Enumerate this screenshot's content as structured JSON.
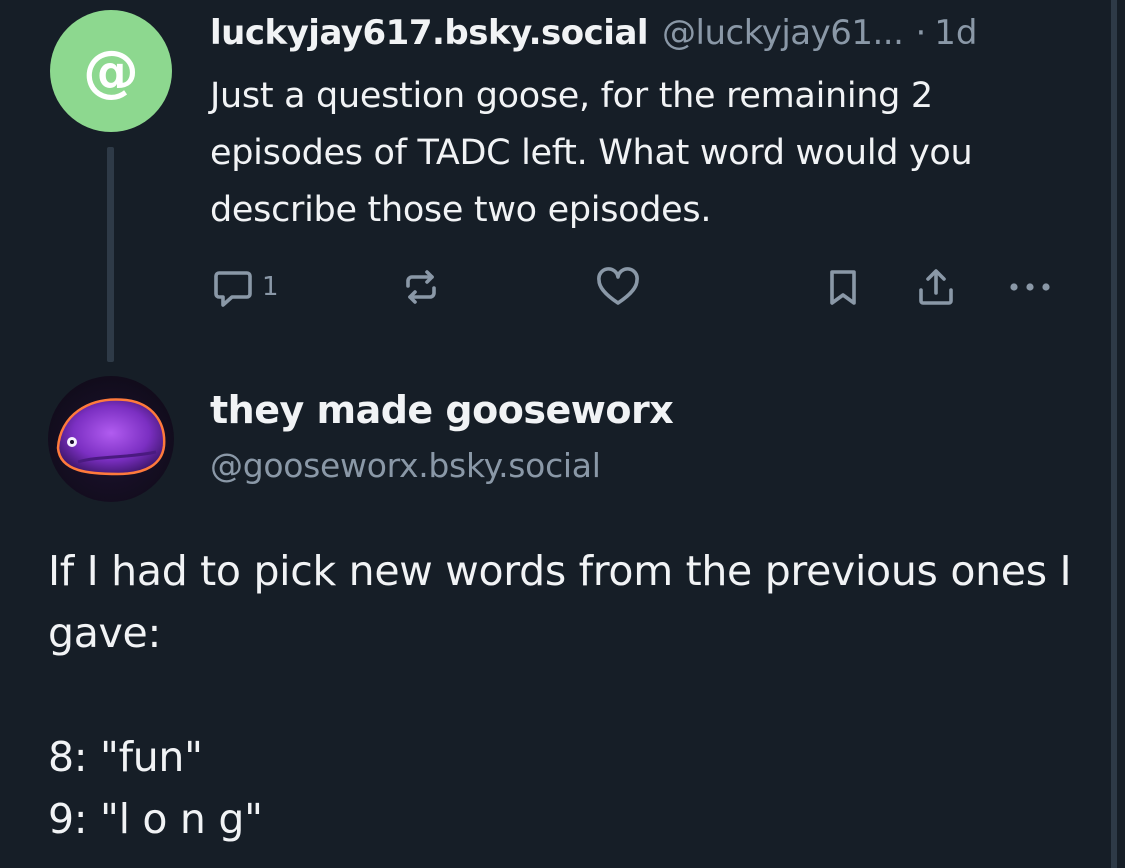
{
  "parent_post": {
    "avatar_glyph": "@",
    "avatar_color": "#8dd88f",
    "author_name": "luckyjay617.bsky.social",
    "author_handle": "@luckyjay61...",
    "separator": "·",
    "time": "1d",
    "text": "Just a question goose, for the remaining 2 episodes of TADC left. What word would you describe those two episodes.",
    "actions": {
      "reply_count": "1",
      "reply_icon": "reply-icon",
      "repost_icon": "repost-icon",
      "like_icon": "heart-icon",
      "bookmark_icon": "bookmark-icon",
      "share_icon": "share-icon",
      "more_icon": "more-icon"
    }
  },
  "main_post": {
    "author_name": "they made gooseworx",
    "author_handle": "@gooseworx.bsky.social",
    "text_intro": "If I had to pick new words from the previous ones I gave:",
    "list": [
      "8: \"fun\"",
      "9: \"l o n g\""
    ]
  },
  "colors": {
    "background": "#161e27",
    "text_primary": "#f1f3f5",
    "text_secondary": "#8a98a7",
    "thread_line": "#2e3a47"
  }
}
